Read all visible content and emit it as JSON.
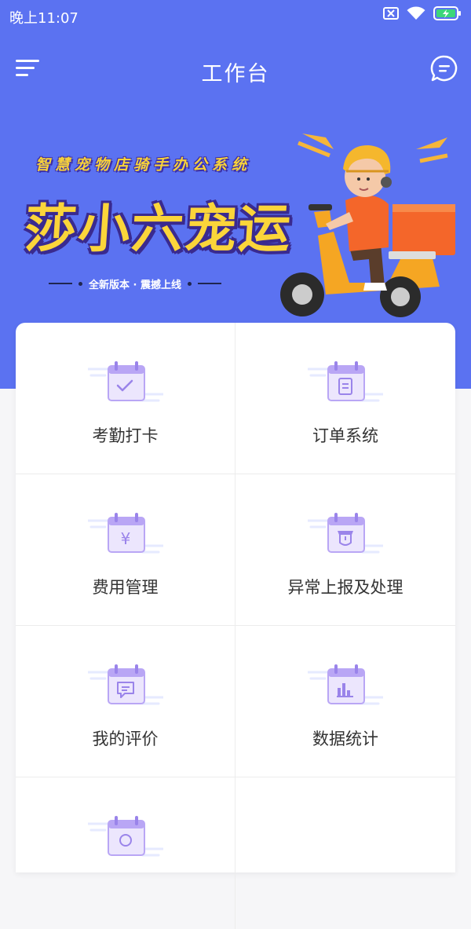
{
  "status_bar": {
    "time": "晚上11:07"
  },
  "header": {
    "title": "工作台"
  },
  "banner": {
    "subtitle": "智慧宠物店骑手办公系统",
    "title": "莎小六宠运",
    "tagline": "全新版本 · 震撼上线"
  },
  "grid": {
    "items": [
      {
        "label": "考勤打卡",
        "icon": "calendar-check-icon"
      },
      {
        "label": "订单系统",
        "icon": "calendar-clipboard-icon"
      },
      {
        "label": "费用管理",
        "icon": "calendar-yen-icon"
      },
      {
        "label": "异常上报及处理",
        "icon": "calendar-alert-icon"
      },
      {
        "label": "我的评价",
        "icon": "calendar-comment-icon"
      },
      {
        "label": "数据统计",
        "icon": "calendar-chart-icon"
      },
      {
        "label": "",
        "icon": "calendar-partial-icon"
      }
    ]
  },
  "colors": {
    "primary": "#5b72f1",
    "icon_purple": "#b9a6f5",
    "icon_stroke": "#9a84ea",
    "banner_yellow": "#fbd53a"
  }
}
